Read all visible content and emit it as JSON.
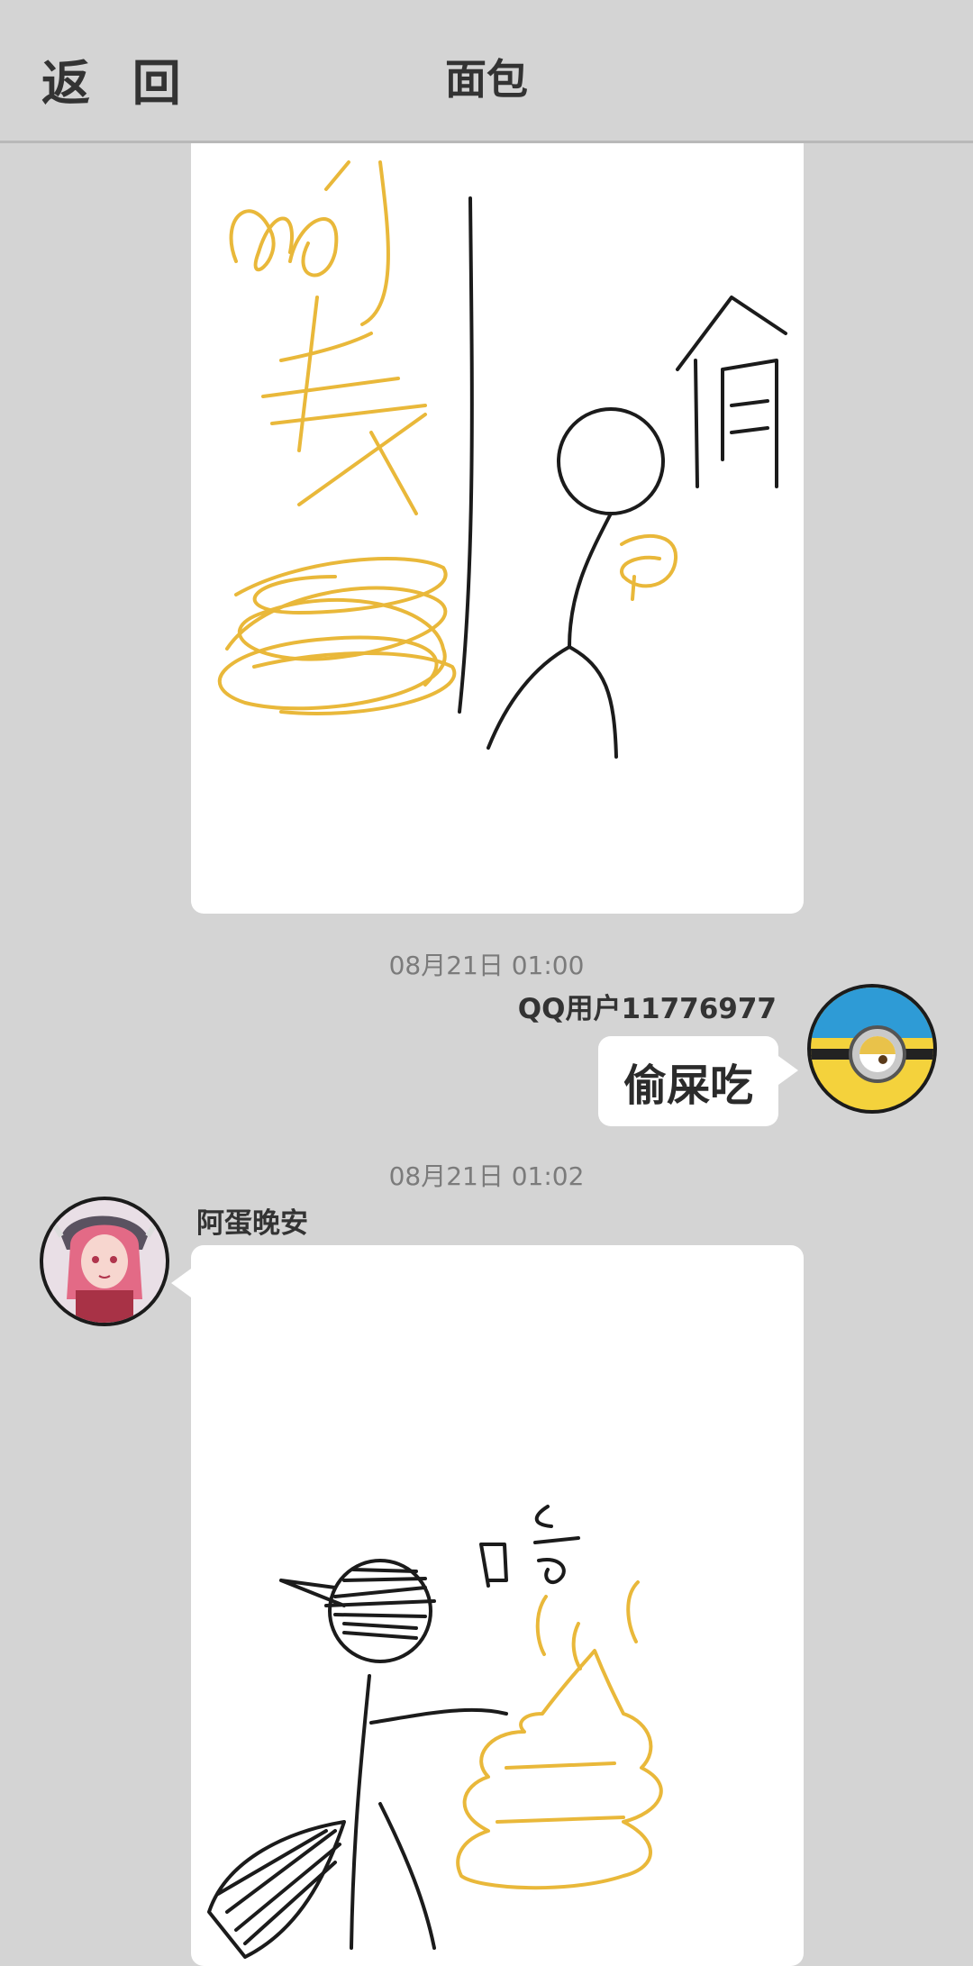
{
  "header": {
    "back_label": "返 回",
    "title": "面包"
  },
  "colors": {
    "background": "#d4d4d4",
    "bubble": "#ffffff",
    "ink": "#1b1b1b",
    "accent_ink": "#e9b83a"
  },
  "messages": [
    {
      "kind": "drawing",
      "drawing_text": [
        "偷"
      ],
      "sender": "self"
    },
    {
      "kind": "text",
      "timestamp": "08月21日  01:00",
      "sender_name": "QQ用户11776977",
      "text": "偷屎吃",
      "avatar_icon": "minion-avatar",
      "sender": "self"
    },
    {
      "kind": "drawing",
      "timestamp": "08月21日  01:02",
      "sender_name": "阿蛋晚安",
      "avatar_icon": "anime-girl-avatar",
      "drawing_text": [
        "吃"
      ],
      "sender": "other"
    }
  ]
}
